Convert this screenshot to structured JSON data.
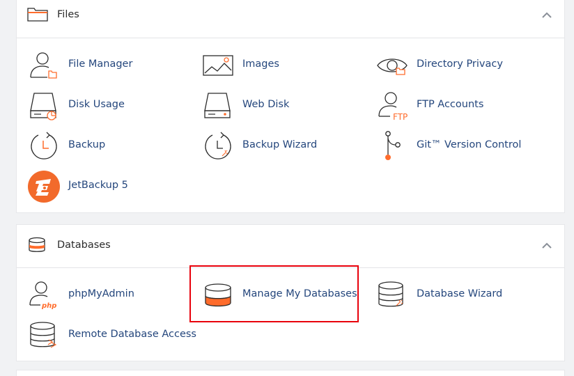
{
  "colors": {
    "accent": "#ff6c2c",
    "link": "#24467c",
    "highlight": "#e8000b",
    "icon_stroke": "#2b2b2b"
  },
  "files": {
    "title": "Files",
    "items": [
      {
        "label": "File Manager",
        "icon": "file-manager-icon"
      },
      {
        "label": "Images",
        "icon": "images-icon"
      },
      {
        "label": "Directory Privacy",
        "icon": "directory-privacy-icon"
      },
      {
        "label": "Disk Usage",
        "icon": "disk-usage-icon"
      },
      {
        "label": "Web Disk",
        "icon": "web-disk-icon"
      },
      {
        "label": "FTP Accounts",
        "icon": "ftp-accounts-icon"
      },
      {
        "label": "Backup",
        "icon": "backup-icon"
      },
      {
        "label": "Backup Wizard",
        "icon": "backup-wizard-icon"
      },
      {
        "label": "Git™ Version Control",
        "icon": "git-icon"
      },
      {
        "label": "JetBackup 5",
        "icon": "jetbackup-icon"
      }
    ]
  },
  "databases": {
    "title": "Databases",
    "items": [
      {
        "label": "phpMyAdmin",
        "icon": "phpmyadmin-icon",
        "icon_text": "php"
      },
      {
        "label": "Manage My Databases",
        "icon": "manage-databases-icon"
      },
      {
        "label": "Database Wizard",
        "icon": "database-wizard-icon"
      },
      {
        "label": "Remote Database Access",
        "icon": "remote-database-icon"
      }
    ]
  },
  "ftp_icon_text": "FTP"
}
